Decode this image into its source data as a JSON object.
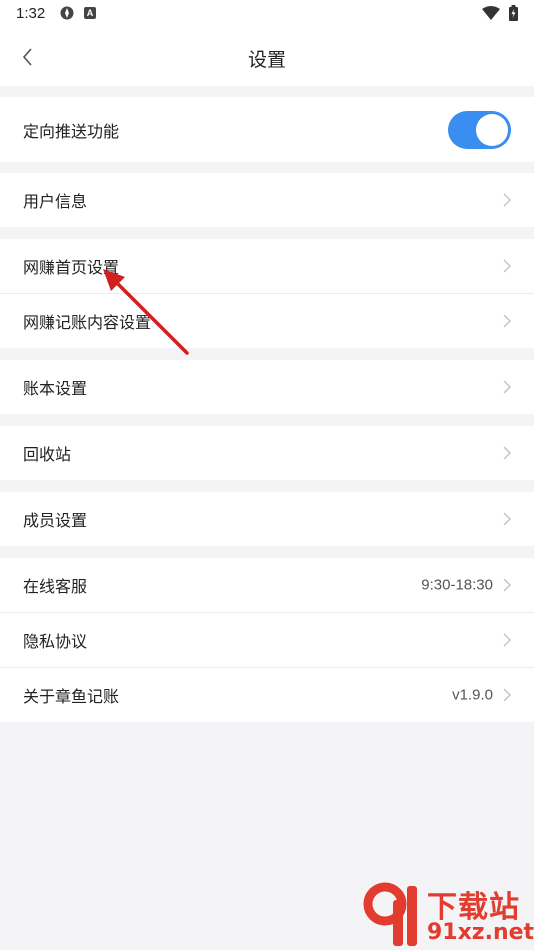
{
  "status_bar": {
    "time": "1:32",
    "app_icon_letter": "A"
  },
  "header": {
    "title": "设置"
  },
  "groups": [
    {
      "rows": [
        {
          "label": "定向推送功能",
          "type": "toggle",
          "on": true
        }
      ]
    },
    {
      "rows": [
        {
          "label": "用户信息"
        }
      ]
    },
    {
      "rows": [
        {
          "label": "网赚首页设置"
        },
        {
          "label": "网赚记账内容设置"
        }
      ]
    },
    {
      "rows": [
        {
          "label": "账本设置"
        }
      ]
    },
    {
      "rows": [
        {
          "label": "回收站"
        }
      ]
    },
    {
      "rows": [
        {
          "label": "成员设置"
        }
      ]
    },
    {
      "rows": [
        {
          "label": "在线客服",
          "value": "9:30-18:30"
        },
        {
          "label": "隐私协议"
        },
        {
          "label": "关于章鱼记账",
          "value": "v1.9.0"
        }
      ]
    }
  ],
  "watermark": {
    "top_text": "下载站",
    "bottom_text": "91xz.net"
  },
  "colors": {
    "toggle_on": "#3a8ef0",
    "annotation_arrow": "#d0201f",
    "background": "#f4f4f6"
  },
  "icons": {
    "back": "chevron-left-icon",
    "row_arrow": "chevron-right-icon",
    "wifi": "wifi-icon",
    "battery": "battery-icon"
  }
}
